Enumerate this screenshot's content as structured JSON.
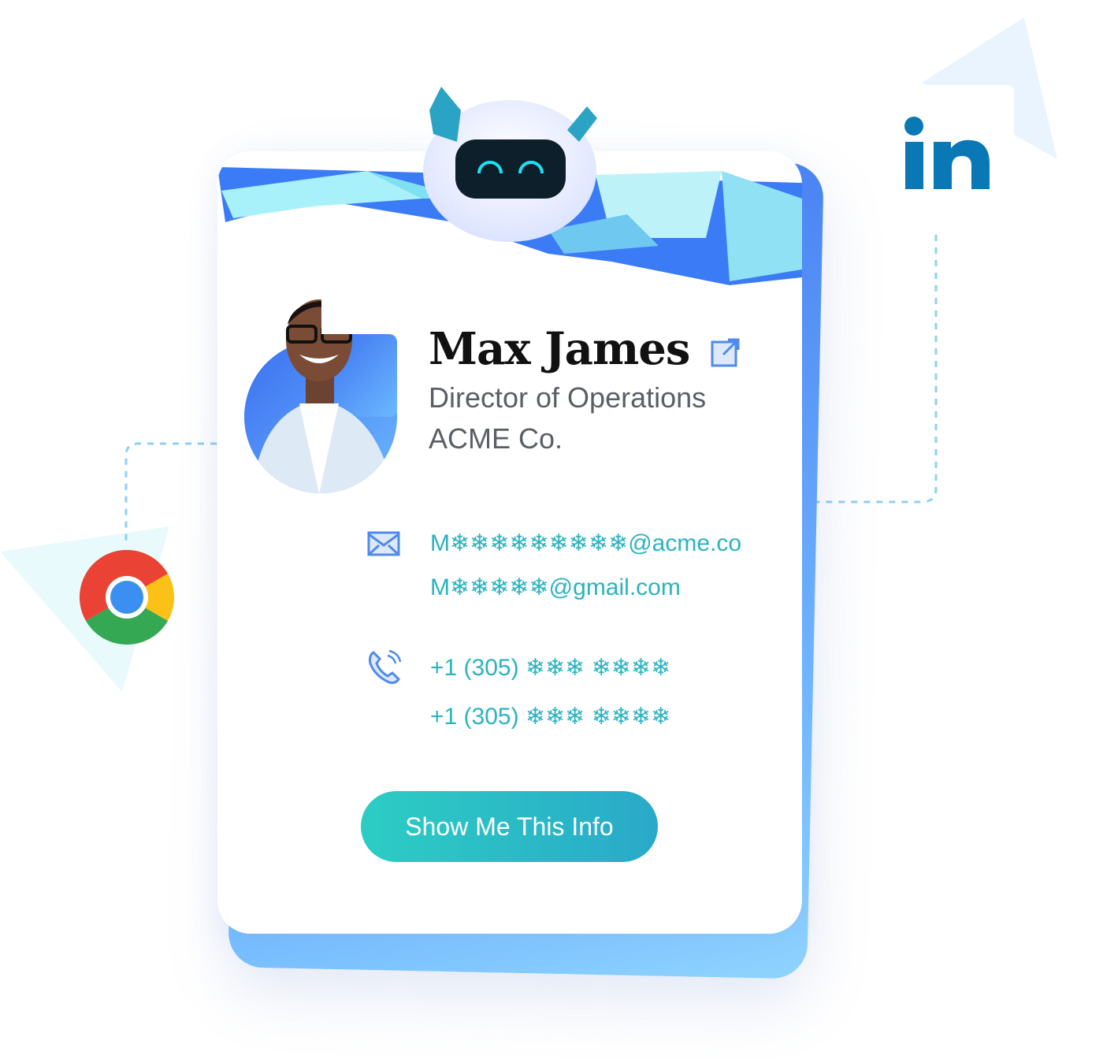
{
  "profile": {
    "name": "Max James",
    "job_title": "Director of Operations",
    "company": "ACME Co."
  },
  "contacts": {
    "emails": [
      "M❄❄❄❄❄❄❄❄❄@acme.co",
      "M❄❄❄❄❄@gmail.com"
    ],
    "phones": [
      "+1 (305) ❄❄❄ ❄❄❄❄",
      "+1 (305) ❄❄❄ ❄❄❄❄"
    ]
  },
  "actions": {
    "show_info_label": "Show Me This Info"
  },
  "icons": {
    "external": "external-link-icon",
    "email": "envelope-icon",
    "phone": "phone-icon",
    "linkedin": "linkedin-logo",
    "chrome": "chrome-logo",
    "mascot": "robot-mascot"
  },
  "logos": {
    "linkedin_text": "in"
  },
  "colors": {
    "accent": "#2bb3c0",
    "brand_blue": "#3b6ff0",
    "linkedin": "#0a78b5",
    "button": "#2cc0c6"
  }
}
